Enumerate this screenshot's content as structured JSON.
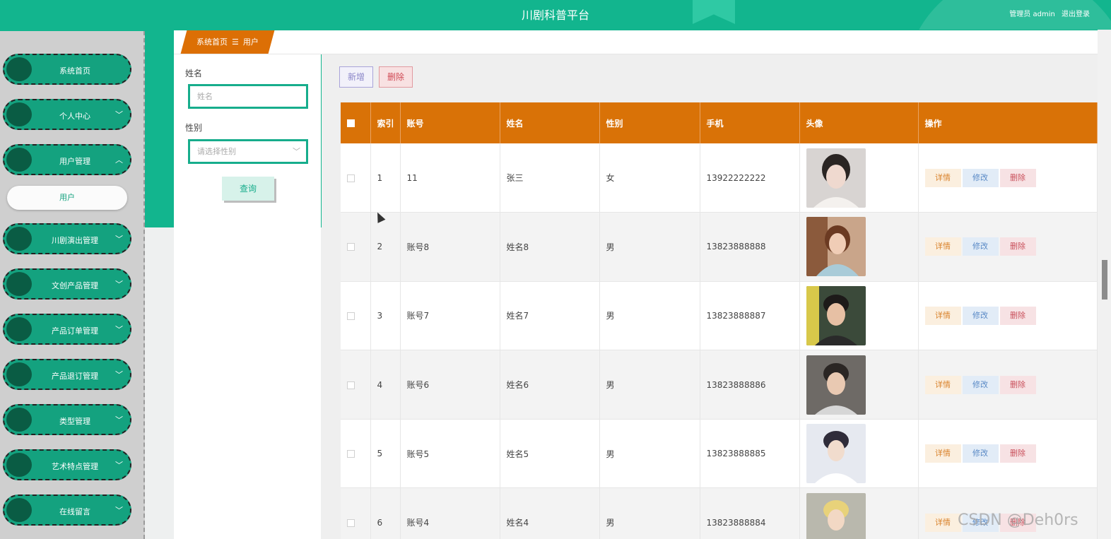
{
  "header": {
    "title": "川剧科普平台",
    "user_label": "管理员 admin",
    "logout": "退出登录"
  },
  "sidebar": {
    "items": [
      {
        "label": "系统首页",
        "chevron": ""
      },
      {
        "label": "个人中心",
        "chevron": "﹀"
      },
      {
        "label": "用户管理",
        "chevron": "︿"
      },
      {
        "label": "川剧演出管理",
        "chevron": "﹀"
      },
      {
        "label": "文创产品管理",
        "chevron": "﹀"
      },
      {
        "label": "产品订单管理",
        "chevron": "﹀"
      },
      {
        "label": "产品退订管理",
        "chevron": "﹀"
      },
      {
        "label": "类型管理",
        "chevron": "﹀"
      },
      {
        "label": "艺术特点管理",
        "chevron": "﹀"
      },
      {
        "label": "在线留言",
        "chevron": "﹀"
      }
    ],
    "submenu": "用户"
  },
  "breadcrumb": {
    "home": "系统首页",
    "separator": "☰",
    "current": "用户"
  },
  "search": {
    "name_label": "姓名",
    "name_placeholder": "姓名",
    "gender_label": "性别",
    "gender_placeholder": "请选择性别",
    "query_button": "查询"
  },
  "toolbar": {
    "add_label": "新增",
    "delete_label": "删除"
  },
  "table": {
    "columns": [
      "",
      "索引",
      "账号",
      "姓名",
      "性别",
      "手机",
      "头像",
      "操作"
    ],
    "rows": [
      {
        "index": "1",
        "account": "11",
        "name": "张三",
        "gender": "女",
        "phone": "13922222222",
        "avatar": "avatar-female-1"
      },
      {
        "index": "2",
        "account": "账号8",
        "name": "姓名8",
        "gender": "男",
        "phone": "13823888888",
        "avatar": "avatar-female-2"
      },
      {
        "index": "3",
        "account": "账号7",
        "name": "姓名7",
        "gender": "男",
        "phone": "13823888887",
        "avatar": "avatar-male-1"
      },
      {
        "index": "4",
        "account": "账号6",
        "name": "姓名6",
        "gender": "男",
        "phone": "13823888886",
        "avatar": "avatar-male-2"
      },
      {
        "index": "5",
        "account": "账号5",
        "name": "姓名5",
        "gender": "男",
        "phone": "13823888885",
        "avatar": "avatar-male-3"
      },
      {
        "index": "6",
        "account": "账号4",
        "name": "姓名4",
        "gender": "男",
        "phone": "13823888884",
        "avatar": "avatar-male-4"
      }
    ],
    "actions": {
      "detail": "详情",
      "edit": "修改",
      "remove": "删除"
    }
  },
  "watermark": "CSDN @Deh0rs",
  "colors": {
    "primary": "#12b58e",
    "header_orange": "#d97207",
    "menu_green": "#14a27f"
  }
}
